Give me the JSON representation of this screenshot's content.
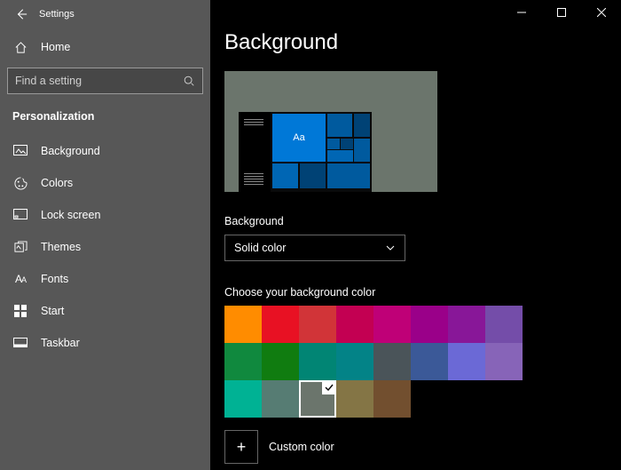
{
  "window": {
    "title": "Settings"
  },
  "sidebar": {
    "home_label": "Home",
    "search_placeholder": "Find a setting",
    "category_label": "Personalization",
    "items": [
      {
        "label": "Background"
      },
      {
        "label": "Colors"
      },
      {
        "label": "Lock screen"
      },
      {
        "label": "Themes"
      },
      {
        "label": "Fonts"
      },
      {
        "label": "Start"
      },
      {
        "label": "Taskbar"
      }
    ]
  },
  "page": {
    "title": "Background",
    "preview_tile_text": "Aa",
    "background_label": "Background",
    "background_value": "Solid color",
    "choose_color_label": "Choose your background color",
    "custom_color_label": "Custom color",
    "colors": [
      "#ff8c00",
      "#e81123",
      "#d13438",
      "#c30052",
      "#bf0077",
      "#9a0089",
      "#881798",
      "#744da9",
      "#10893e",
      "#107c10",
      "#018574",
      "#038387",
      "#4a5459",
      "#3b5998",
      "#6b69d6",
      "#8764b8",
      "#00b294",
      "#567c73",
      "#6b756c",
      "#847545",
      "#724f2f"
    ],
    "selected_color_index": 18
  }
}
